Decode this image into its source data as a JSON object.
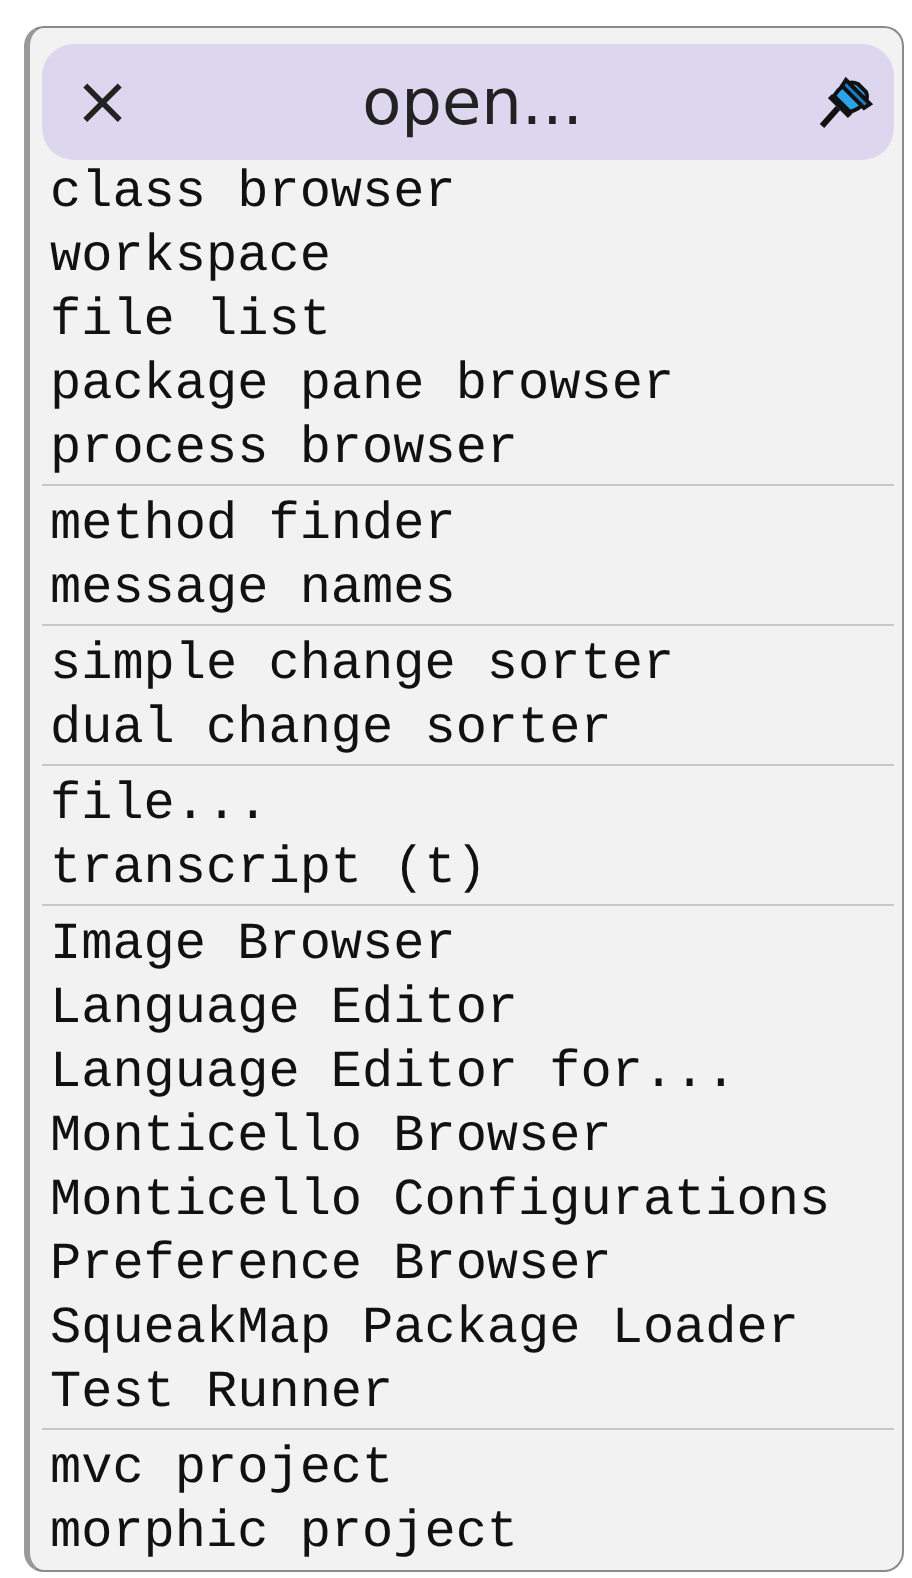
{
  "menu": {
    "close_glyph": "×",
    "title": "open...",
    "groups": [
      {
        "items": [
          "class browser",
          "workspace",
          "file list",
          "package pane browser",
          "process browser"
        ]
      },
      {
        "items": [
          "method finder",
          "message names"
        ]
      },
      {
        "items": [
          "simple change sorter",
          "dual change sorter"
        ]
      },
      {
        "items": [
          "file...",
          "transcript (t)"
        ]
      },
      {
        "items": [
          "Image Browser",
          "Language Editor",
          "Language Editor for...",
          "Monticello Browser",
          "Monticello Configurations",
          "Preference Browser",
          "SqueakMap Package Loader",
          "Test Runner"
        ]
      },
      {
        "items": [
          "mvc project",
          "morphic project"
        ]
      }
    ]
  }
}
